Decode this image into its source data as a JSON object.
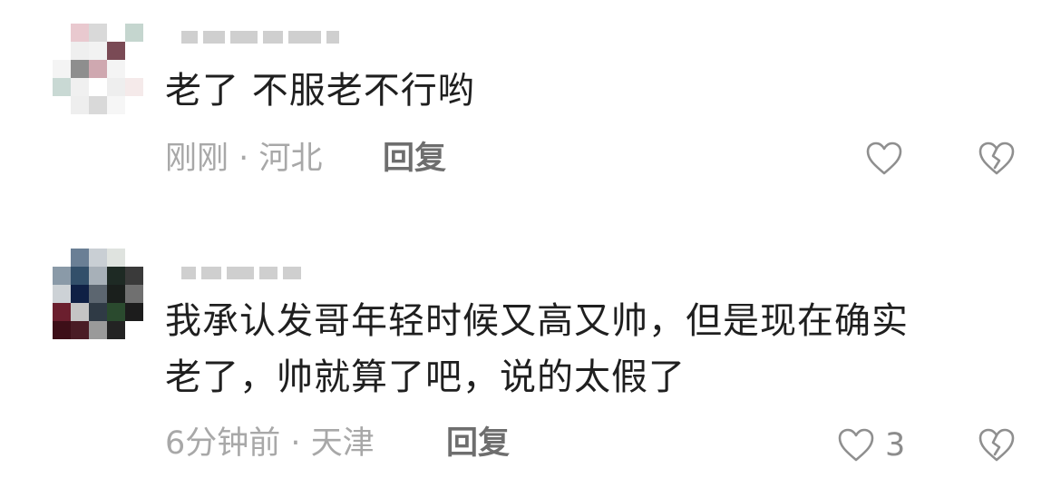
{
  "comments": [
    {
      "text": "老了 不服老不行哟",
      "time": "刚刚",
      "separator": "·",
      "location": "河北",
      "reply_label": "回复",
      "like_icon": "heart-outline-icon",
      "dislike_icon": "broken-heart-icon",
      "avatar_pixels": [
        "#ffffff",
        "#e9c9cf",
        "#d9d9d9",
        "#ffffff",
        "#c5d6cf",
        "#ffffff",
        "#efefef",
        "#f2f2f2",
        "#7a4a55",
        "#ffffff",
        "#f4f4f4",
        "#8e8e8e",
        "#cfa8b0",
        "#f4f4f4",
        "#ffffff",
        "#c9d9d4",
        "#f0f0f0",
        "#ffffff",
        "#eeeeee",
        "#f5eaea",
        "#ffffff",
        "#eeeeee",
        "#d9d9d9",
        "#f6f6f6",
        "#ffffff"
      ]
    },
    {
      "text_line1": "我承认发哥年轻时候又高又帅，但是现在确实",
      "text_line2": "老了，帅就算了吧，说的太假了",
      "time": "6分钟前",
      "separator": "·",
      "location": "天津",
      "reply_label": "回复",
      "like_count": "3",
      "like_icon": "heart-outline-icon",
      "dislike_icon": "broken-heart-icon",
      "avatar_pixels": [
        "#ffffff",
        "#6a7f95",
        "#c9cfd4",
        "#dfe3df",
        "#ffffff",
        "#8a9aa8",
        "#324f6a",
        "#a7b0b8",
        "#1e2a24",
        "#3a3a3a",
        "#cdd2d6",
        "#0f2045",
        "#5c6670",
        "#1a1f1c",
        "#707070",
        "#6b1f2e",
        "#c4c4c4",
        "#2f3a45",
        "#2a4a2e",
        "#1c1c1c",
        "#3d0f18",
        "#4a1c25",
        "#9a9a9a",
        "#232323",
        "#ffffff"
      ]
    }
  ]
}
